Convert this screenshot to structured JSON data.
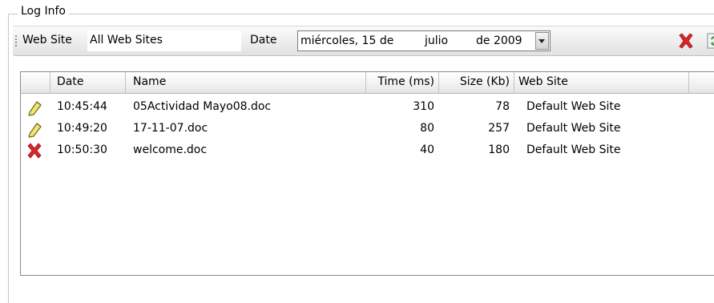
{
  "group": {
    "title": "Log Info"
  },
  "toolbar": {
    "website_label": "Web Site",
    "website_value": "All Web Sites",
    "date_label": "Date",
    "date": {
      "weekday_day": "miércoles, 15 de",
      "month": "julio",
      "year": "de 2009"
    },
    "delete_icon": "delete-x-icon",
    "refresh_icon": "refresh-icon"
  },
  "grid": {
    "columns": [
      "",
      "Date",
      "Name",
      "Time (ms)",
      "Size (Kb)",
      "Web Site"
    ],
    "rows": [
      {
        "status": "pencil-icon",
        "date": "10:45:44",
        "name": "05Actividad Mayo08.doc",
        "time": "310",
        "size": "78",
        "site": "Default Web Site"
      },
      {
        "status": "pencil-icon",
        "date": "10:49:20",
        "name": "17-11-07.doc",
        "time": "80",
        "size": "257",
        "site": "Default Web Site"
      },
      {
        "status": "error-x-icon",
        "date": "10:50:30",
        "name": "welcome.doc",
        "time": "40",
        "size": "180",
        "site": "Default Web Site"
      }
    ]
  },
  "colors": {
    "delete_red": "#d8262a",
    "refresh_green": "#2e9a2e",
    "pencil_yellow": "#f2e66a"
  }
}
